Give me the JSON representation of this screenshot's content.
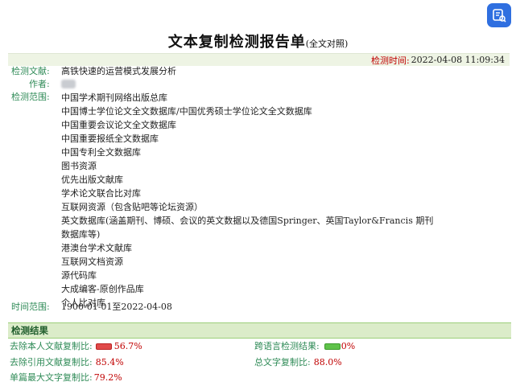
{
  "report": {
    "title": "文本复制检测报告单",
    "subtitle": "(全文对照)",
    "time_label": "检测时间:",
    "time_value": "2022-04-08 11:09:34",
    "doc_label": "检测文献:",
    "doc_value": "高铁快速的运营模式发展分析",
    "author_label": "作者:",
    "scope_label": "检测范围:",
    "scope_items": [
      "中国学术期刊网络出版总库",
      "中国博士学位论文全文数据库/中国优秀硕士学位论文全文数据库",
      "中国重要会议论文全文数据库",
      "中国重要报纸全文数据库",
      "中国专利全文数据库",
      "图书资源",
      "优先出版文献库",
      "学术论文联合比对库",
      "互联网资源（包含贴吧等论坛资源）",
      "英文数据库(涵盖期刊、博硕、会议的英文数据以及德国Springer、英国Taylor&Francis 期刊数据库等)",
      "港澳台学术文献库",
      "互联网文档资源",
      "源代码库",
      "大成编客-原创作品库",
      "个人比对库"
    ],
    "period_label": "时间范围:",
    "period_value": "1900-01-01至2022-04-08"
  },
  "results": {
    "header": "检测结果",
    "exclude_self_label": "去除本人文献复制比:",
    "exclude_self_value": "56.7%",
    "exclude_self_fraction": 0.567,
    "cross_lang_label": "跨语言检测结果:",
    "cross_lang_value": "0%",
    "exclude_cite_label": "去除引用文献复制比:",
    "exclude_cite_value": "85.4%",
    "total_label": "总文字复制比:",
    "total_value": "88.0%",
    "max_single_label": "单篇最大文字复制比:",
    "max_single_value": "79.2%"
  },
  "colors": {
    "label_green": "#2f8b57",
    "value_red": "#c00000",
    "result_header_bg": "#dbecc9"
  },
  "icons": {
    "top_right": "app-icon"
  }
}
